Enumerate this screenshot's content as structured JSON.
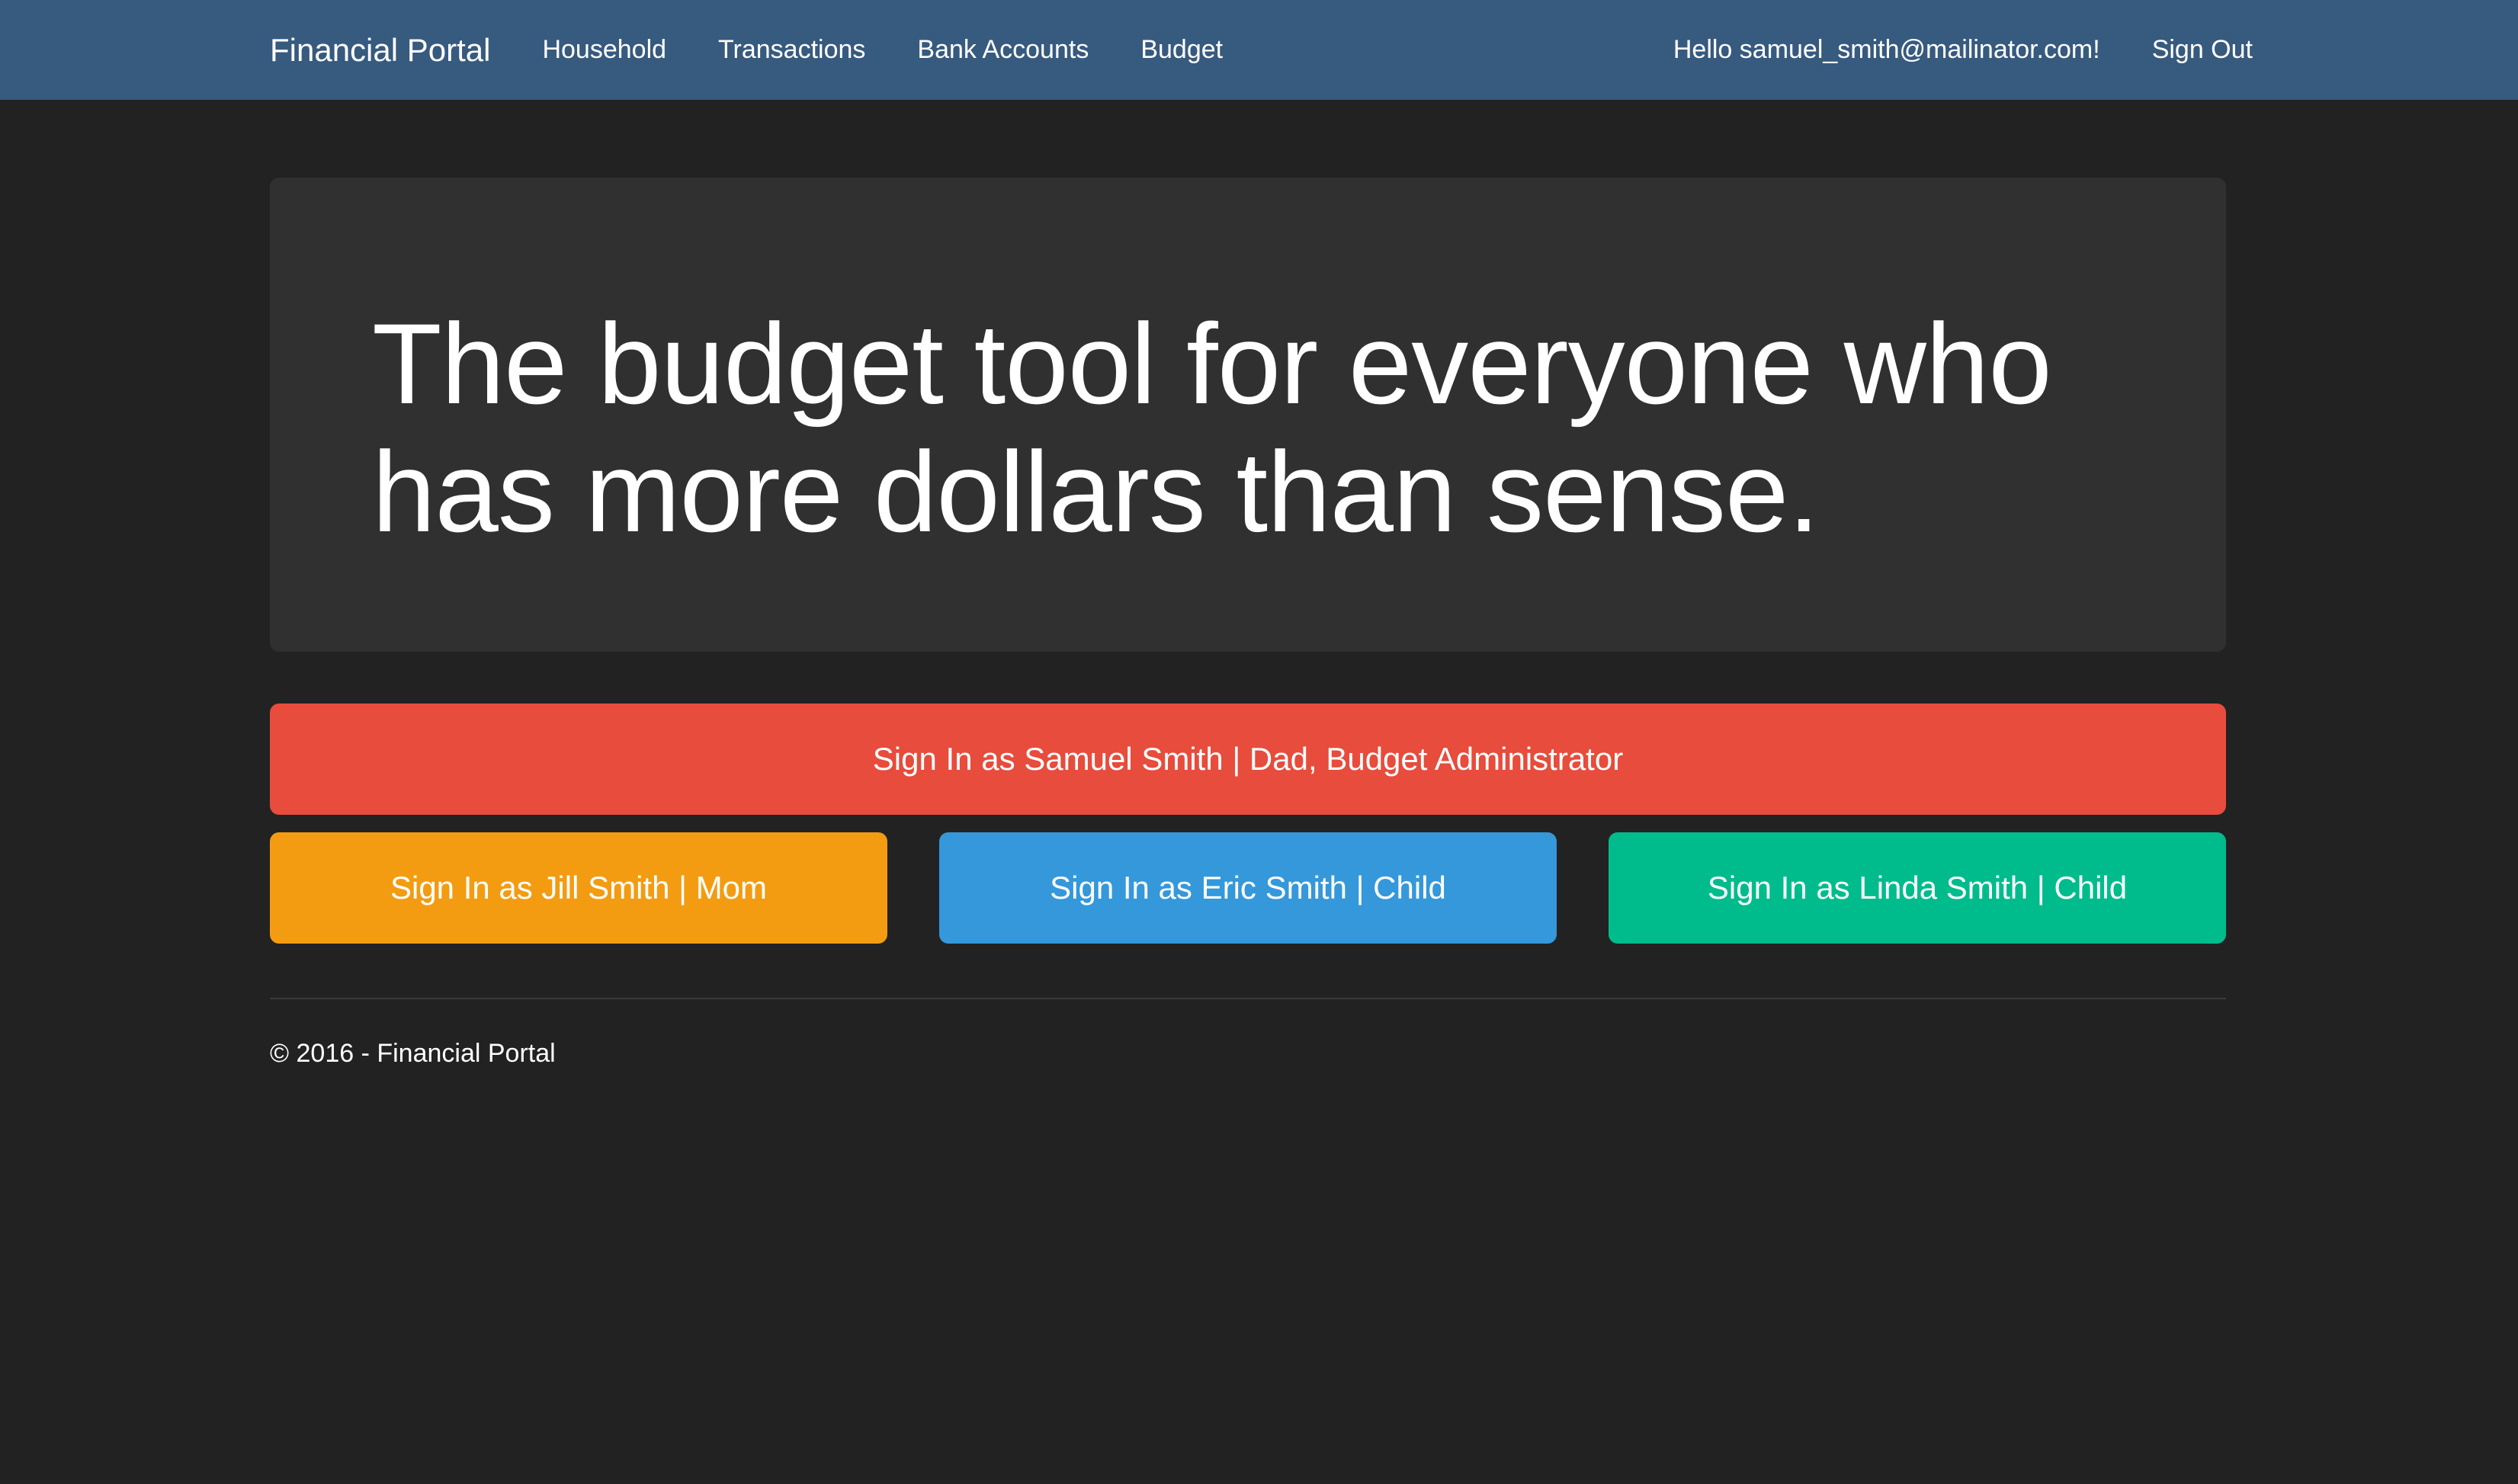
{
  "nav": {
    "brand": "Financial Portal",
    "links": [
      "Household",
      "Transactions",
      "Bank Accounts",
      "Budget"
    ],
    "greeting": "Hello samuel_smith@mailinator.com!",
    "sign_out": "Sign Out"
  },
  "hero": {
    "headline": "The budget tool for everyone who has more dollars than sense."
  },
  "buttons": {
    "samuel": "Sign In as Samuel Smith | Dad, Budget Administrator",
    "jill": "Sign In as Jill Smith | Mom",
    "eric": "Sign In as Eric Smith | Child",
    "linda": "Sign In as Linda Smith | Child"
  },
  "footer": {
    "text": "© 2016 - Financial Portal"
  },
  "colors": {
    "navbar": "#375a7f",
    "background": "#222222",
    "jumbotron": "#303030",
    "danger": "#e74c3c",
    "warning": "#f39c12",
    "info": "#3498db",
    "success": "#00bc8c"
  }
}
